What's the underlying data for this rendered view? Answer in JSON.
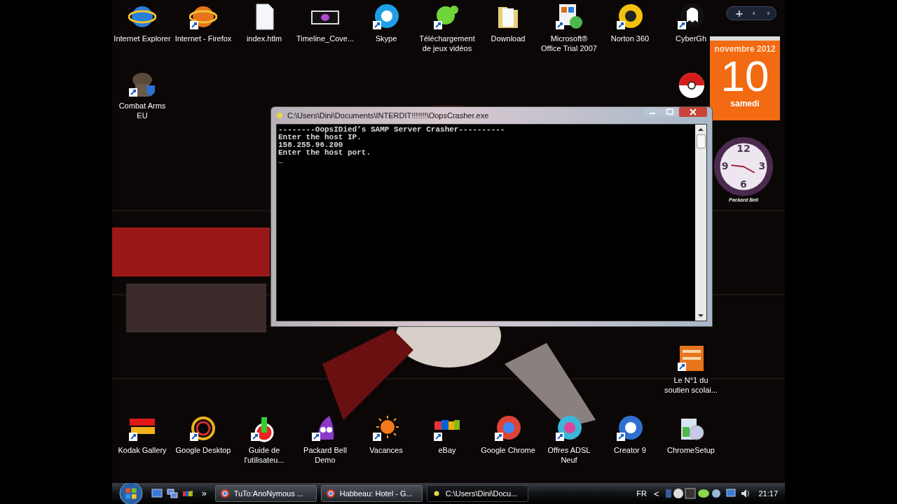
{
  "desktop": {
    "icons_top": [
      {
        "label": "Internet Explorer"
      },
      {
        "label": "Internet - Firefox"
      },
      {
        "label": "index.htlm"
      },
      {
        "label": "Timeline_Cove..."
      },
      {
        "label": "Skype"
      },
      {
        "label": "Téléchargement\nde jeux vidéos"
      },
      {
        "label": "Download"
      },
      {
        "label": "Microsoft®\nOffice Trial 2007"
      },
      {
        "label": "Norton 360"
      },
      {
        "label": "CyberGh"
      }
    ],
    "icons_left": [
      {
        "label": "Combat Arms\nEU"
      }
    ],
    "icons_right": [
      {
        "label": "Le N°1 du\nsoutien scolai..."
      }
    ],
    "icons_bottom": [
      {
        "label": "Kodak Gallery"
      },
      {
        "label": "Google Desktop"
      },
      {
        "label": "Guide de\nl'utilisateu..."
      },
      {
        "label": "Packard Bell\nDemo"
      },
      {
        "label": "Vacances"
      },
      {
        "label": "eBay"
      },
      {
        "label": "Google Chrome"
      },
      {
        "label": "Offres ADSL\nNeuf"
      },
      {
        "label": "Creator 9"
      },
      {
        "label": "ChromeSetup"
      }
    ]
  },
  "console": {
    "title": "C:\\Users\\Dini\\Documents\\INTERDIT!!!!!!!\\OopsCrasher.exe",
    "lines": [
      "--------OopsIDied’s SAMP Server Crasher----------",
      "Enter the host IP.",
      "158.255.96.200",
      "Enter the host port."
    ],
    "cursor": "_"
  },
  "sidebar": {
    "add": "+",
    "calendar": {
      "month": "novembre 2012",
      "day": "10",
      "weekday": "samedi"
    },
    "clock": {
      "numerals": [
        "12",
        "3",
        "6",
        "9"
      ],
      "brand": "Packard Bell"
    }
  },
  "taskbar": {
    "more": "»",
    "tasks": [
      {
        "label": "TuTo:AnoNymous ...",
        "selected": false
      },
      {
        "label": "Habbeau: Hotel - G...",
        "selected": false
      },
      {
        "label": "C:\\Users\\Dini\\Docu...",
        "selected": true
      }
    ],
    "language": "FR",
    "expand": "<",
    "time": "21:17"
  }
}
